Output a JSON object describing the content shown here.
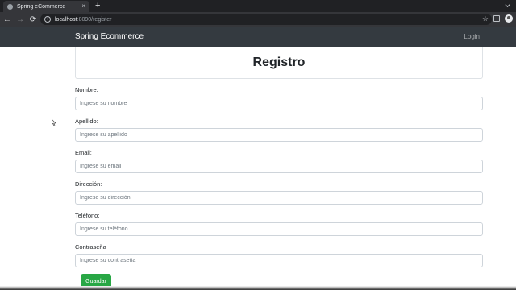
{
  "browser": {
    "tab_title": "Spring eCommerce",
    "tab_close": "×",
    "new_tab": "+",
    "url_host": "localhost",
    "url_path": ":8090/register",
    "back": "←",
    "forward": "→",
    "reload": "⟳",
    "star": "☆"
  },
  "navbar": {
    "brand": "Spring Ecommerce",
    "login": "Login"
  },
  "form": {
    "title": "Registro",
    "fields": [
      {
        "label": "Nombre:",
        "placeholder": "Ingrese su nombre"
      },
      {
        "label": "Apellido:",
        "placeholder": "Ingrese su apellido"
      },
      {
        "label": "Email:",
        "placeholder": "Ingrese su email"
      },
      {
        "label": "Dirección:",
        "placeholder": "Ingrese su dirección"
      },
      {
        "label": "Teléfono:",
        "placeholder": "Ingrese su teléfono"
      },
      {
        "label": "Contraseña",
        "placeholder": "Ingrese su contraseña"
      }
    ],
    "submit": "Guardar"
  },
  "colors": {
    "navbar": "#343a40",
    "submit": "#28a745"
  }
}
